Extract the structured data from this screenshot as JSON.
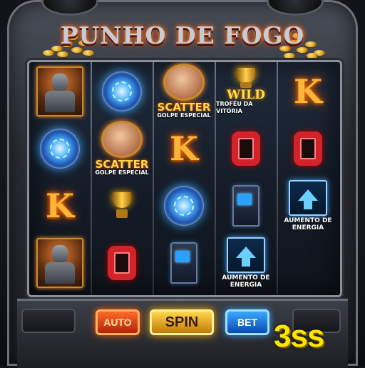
{
  "game": {
    "title": "PUNHO DE FOGO",
    "brand": "3ss"
  },
  "reels": {
    "columns": [
      [
        {
          "type": "fighter",
          "icon": "armored-fighter-icon"
        },
        {
          "type": "orb",
          "icon": "lightning-orb-icon"
        },
        {
          "type": "letter",
          "text": "K"
        },
        {
          "type": "fighter",
          "icon": "armored-fighter-icon"
        }
      ],
      [
        {
          "type": "orb",
          "icon": "lightning-orb-icon"
        },
        {
          "type": "scatter",
          "icon": "fist-icon",
          "label": "SCATTER",
          "sublabel": "GOLPE ESPECIAL"
        },
        {
          "type": "trophy",
          "icon": "trophy-icon"
        },
        {
          "type": "letter",
          "text": "O"
        }
      ],
      [
        {
          "type": "scatter",
          "icon": "fist-icon",
          "label": "SCATTER",
          "sublabel": "GOLPE ESPECIAL"
        },
        {
          "type": "letter",
          "text": "K"
        },
        {
          "type": "orb",
          "icon": "lightning-orb-icon"
        },
        {
          "type": "arcade",
          "icon": "arcade-cabinet-icon"
        }
      ],
      [
        {
          "type": "wild",
          "icon": "trophy-icon",
          "label": "WILD",
          "sublabel": "TROFÉU DA VITÓRIA"
        },
        {
          "type": "letter",
          "text": "O"
        },
        {
          "type": "arcade",
          "icon": "arcade-cabinet-icon"
        },
        {
          "type": "boost",
          "icon": "arrow-up-icon",
          "label": "AUMENTO DE ENERGIA"
        }
      ],
      [
        {
          "type": "letter",
          "text": "K"
        },
        {
          "type": "letter",
          "text": "O"
        },
        {
          "type": "boost",
          "icon": "arrow-up-icon",
          "label": "AUMENTO DE ENERGIA"
        },
        {
          "type": "empty"
        }
      ]
    ]
  },
  "controls": {
    "auto_label": "AUTO",
    "spin_label": "SPIN",
    "bet_label": "BET"
  },
  "colors": {
    "auto": "#ff6a2a",
    "spin": "#ffd84a",
    "bet": "#3aa8ff",
    "brand": "#ffe600"
  }
}
